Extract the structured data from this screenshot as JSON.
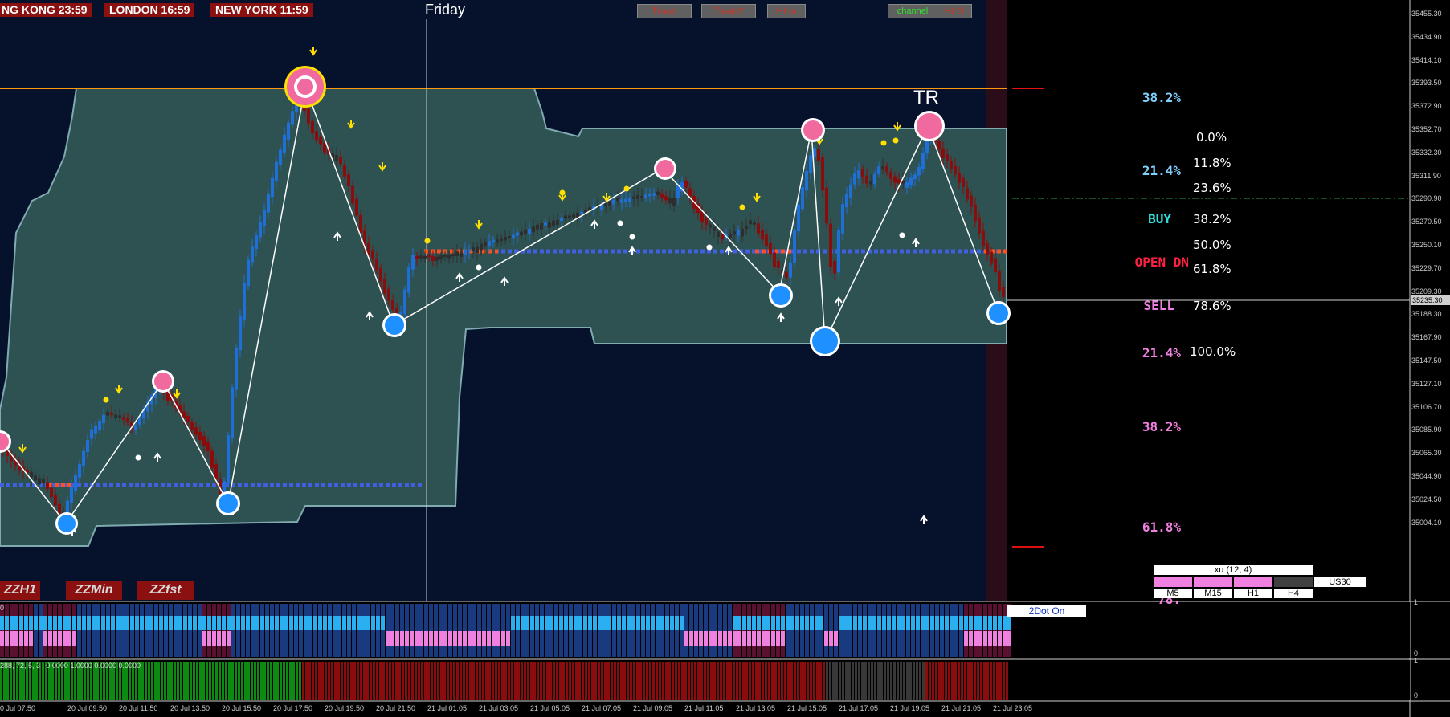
{
  "sessions": {
    "hongkong": "NG KONG 23:59",
    "london": "LONDON  16:59",
    "newyork": "NEW YORK 11:59"
  },
  "day_label": "Friday",
  "toolbar": {
    "tmab": "Tmab",
    "tmab2": "Tmab2",
    "hlm": "HLm",
    "channel": "channel",
    "hlg": "HLG"
  },
  "tr_label": "TR",
  "fib_right": {
    "r1": "38.2%",
    "r2": "21.4%",
    "buy": "BUY",
    "open": "OPEN DN",
    "sell": "SELL",
    "r3": "21.4%",
    "r4": "38.2%",
    "r5": "61.8%",
    "r6": "78."
  },
  "fib_levels": [
    "0.0%",
    "11.8%",
    "23.6%",
    "38.2%",
    "50.0%",
    "61.8%",
    "78.6%",
    "100.0%"
  ],
  "zz_buttons": {
    "zzh1": "ZZH1",
    "zzmin": "ZZMin",
    "zzfst": "ZZfst"
  },
  "panel": {
    "xu": "xu (12, 4)",
    "timeframes": [
      "M5",
      "M15",
      "H1",
      "H4"
    ],
    "symbol": "US30",
    "twodot": "2Dot On"
  },
  "indicator2_label": "288, 72, 5, 3 | 0.0000 1.0000 0.0000 0.0000",
  "indicator1_left_label": "0",
  "price_axis": [
    "35455.30",
    "35434.90",
    "35414.10",
    "35393.50",
    "35372.90",
    "35352.70",
    "35332.30",
    "35311.90",
    "35290.90",
    "35270.50",
    "35250.10",
    "35229.70",
    "35209.30",
    "35188.30",
    "35167.90",
    "35147.50",
    "35127.10",
    "35106.70",
    "35085.90",
    "35065.30",
    "35044.90",
    "35024.50",
    "35004.10"
  ],
  "current_price": "35235.30",
  "ind1_axis": [
    "1",
    "0"
  ],
  "ind2_axis": [
    "1",
    "0"
  ],
  "time_axis": [
    "0 Jul 07:50",
    "20 Jul 09:50",
    "20 Jul 11:50",
    "20 Jul 13:50",
    "20 Jul 15:50",
    "20 Jul 17:50",
    "20 Jul 19:50",
    "20 Jul 21:50",
    "21 Jul 01:05",
    "21 Jul 03:05",
    "21 Jul 05:05",
    "21 Jul 07:05",
    "21 Jul 09:05",
    "21 Jul 11:05",
    "21 Jul 13:05",
    "21 Jul 15:05",
    "21 Jul 17:05",
    "21 Jul 19:05",
    "21 Jul 21:05",
    "21 Jul 23:05"
  ],
  "colors": {
    "background": "#06112c",
    "channel": "#2e5252",
    "bull": "#1f6fd8",
    "bear": "#8a0c0c",
    "neutral": "#2e2e2e",
    "high_marker": "#f06aa0",
    "low_marker": "#1e90ff",
    "orange_line": "#ff9a10",
    "blue_dotted": "#4060e0",
    "arrow_up": "#ffffff",
    "arrow_down": "#ffe000"
  }
}
